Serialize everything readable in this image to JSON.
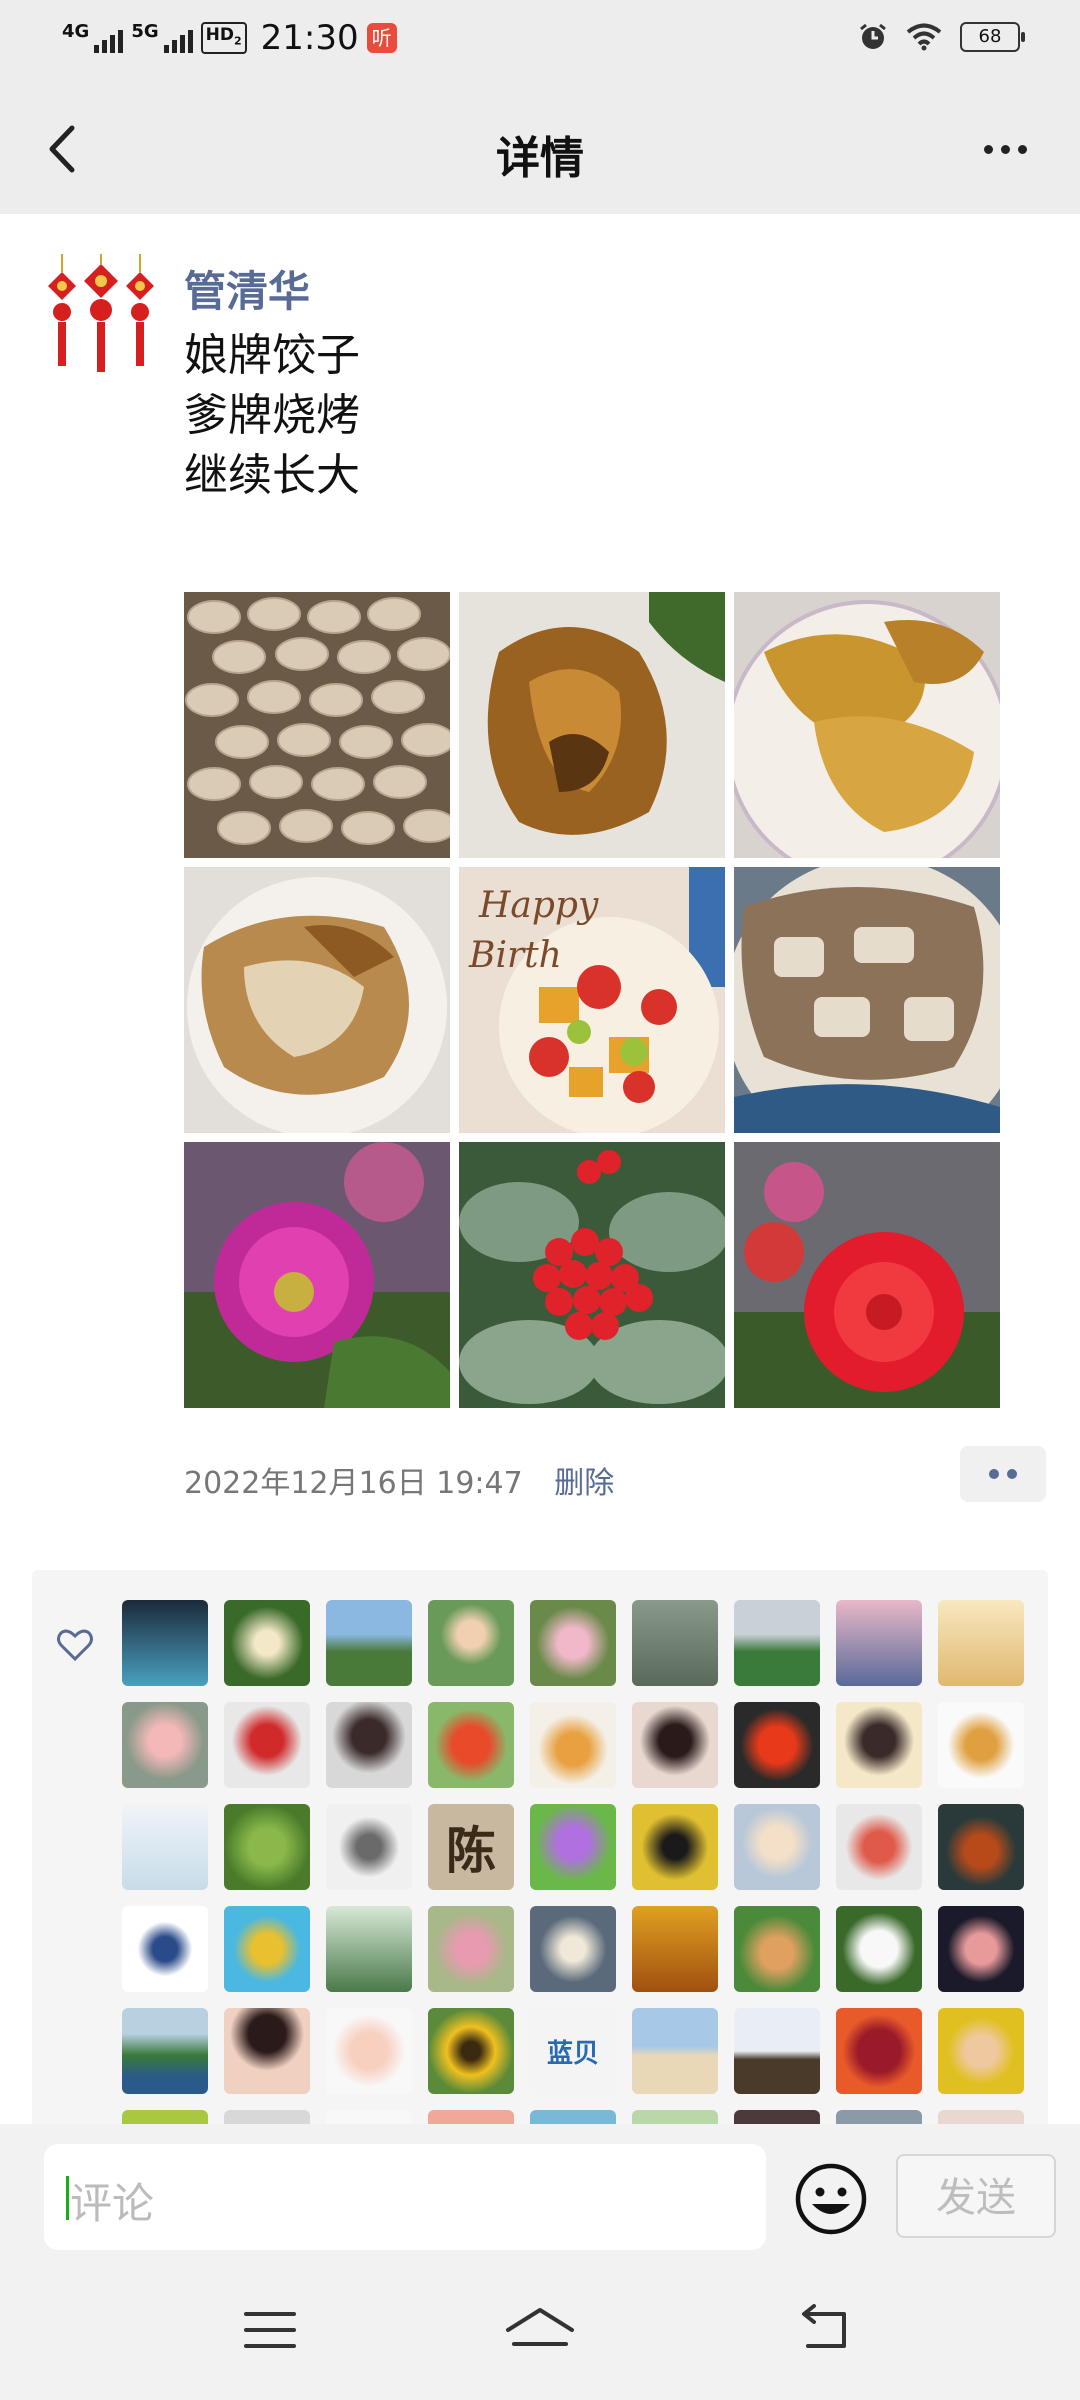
{
  "status_bar": {
    "network1": "4G",
    "network2": "5G",
    "hd": "HD",
    "hd_sub": "2",
    "time": "21:30",
    "listen_badge": "听",
    "battery": "68"
  },
  "header": {
    "title": "详情"
  },
  "post": {
    "author": "管清华",
    "lines": [
      "娘牌饺子",
      "爹牌烧烤",
      "继续长大"
    ],
    "date": "2022年12月16日  19:47",
    "delete_label": "删除",
    "photos": [
      "dumplings",
      "roast-chicken",
      "chicken-legs",
      "roast-meat",
      "birthday-cake",
      "bbq-pieces",
      "purple-dahlia",
      "red-berries",
      "red-dahlia"
    ]
  },
  "likes": {
    "avatar_text": "陈",
    "avatar_text_2": "蓝贝"
  },
  "comment_bar": {
    "placeholder": "评论",
    "send_label": "发送"
  },
  "colors": {
    "link_blue": "#576b95",
    "background": "#ededed",
    "send_disabled": "#bdbdbd"
  }
}
